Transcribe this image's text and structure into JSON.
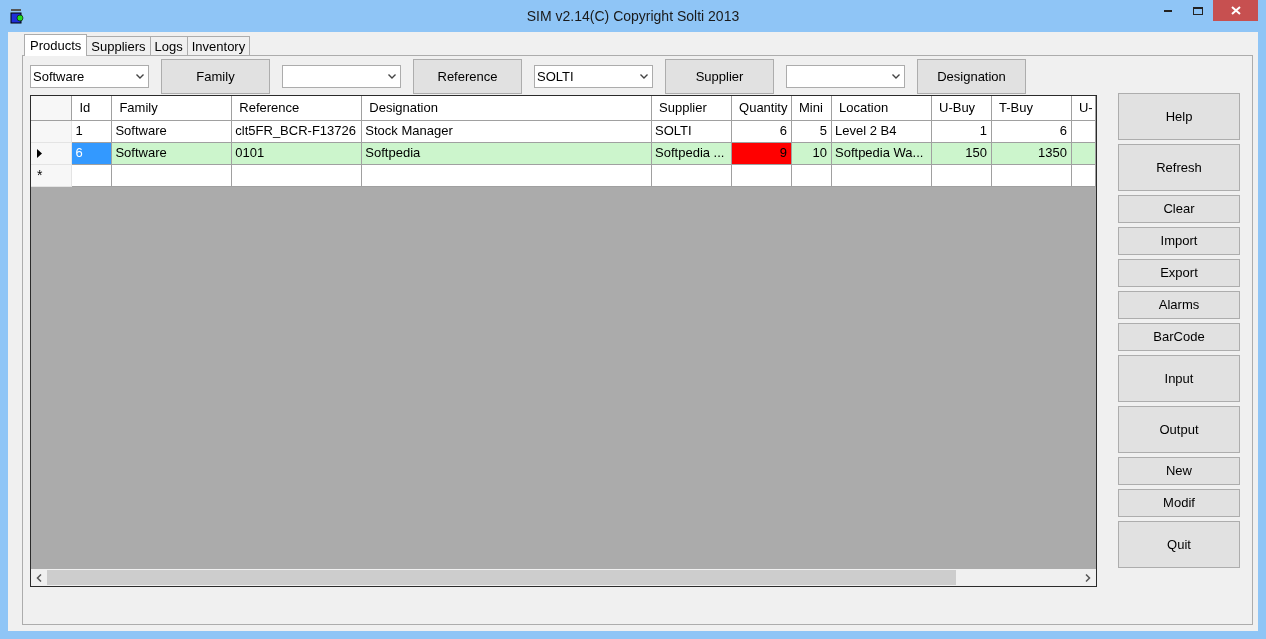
{
  "window": {
    "title": "SIM v2.14(C) Copyright Solti 2013"
  },
  "tabs": [
    {
      "label": "Products",
      "selected": true
    },
    {
      "label": "Suppliers",
      "selected": false
    },
    {
      "label": "Logs",
      "selected": false
    },
    {
      "label": "Inventory",
      "selected": false
    }
  ],
  "filters": [
    {
      "value": "Software",
      "button": "Family"
    },
    {
      "button": "Reference"
    },
    {
      "value": "SOLTI",
      "button": "Supplier"
    },
    {
      "button": "Designation"
    }
  ],
  "table": {
    "columns": [
      {
        "label": "Id",
        "kind": "text"
      },
      {
        "label": "Family",
        "kind": "text"
      },
      {
        "label": "Reference",
        "kind": "text"
      },
      {
        "label": "Designation",
        "kind": "text"
      },
      {
        "label": "Supplier",
        "kind": "text"
      },
      {
        "label": "Quantity",
        "kind": "number"
      },
      {
        "label": "Mini",
        "kind": "number"
      },
      {
        "label": "Location",
        "kind": "text"
      },
      {
        "label": "U-Buy",
        "kind": "number"
      },
      {
        "label": "T-Buy",
        "kind": "number"
      },
      {
        "label": "U-"
      }
    ],
    "rows": [
      {
        "selected": false,
        "current": false,
        "cells": [
          {
            "text": "1",
            "alert": false,
            "focused": false
          },
          {
            "text": "Software",
            "alert": false,
            "focused": false
          },
          {
            "text": "clt5FR_BCR-F13726",
            "alert": false,
            "focused": false
          },
          {
            "text": "Stock Manager",
            "alert": false,
            "focused": false
          },
          {
            "text": "SOLTI",
            "alert": false,
            "focused": false
          },
          {
            "text": "6",
            "alert": false,
            "focused": false
          },
          {
            "text": "5",
            "alert": false,
            "focused": false
          },
          {
            "text": "Level 2 B4",
            "alert": false,
            "focused": false
          },
          {
            "text": "1",
            "alert": false,
            "focused": false
          },
          {
            "text": "6",
            "alert": false,
            "focused": false
          }
        ]
      },
      {
        "selected": true,
        "current": true,
        "cells": [
          {
            "text": "6",
            "alert": false,
            "focused": true
          },
          {
            "text": "Software",
            "alert": false,
            "focused": false
          },
          {
            "text": "0101",
            "alert": false,
            "focused": false
          },
          {
            "text": "Softpedia",
            "alert": false,
            "focused": false
          },
          {
            "text": "Softpedia ...",
            "alert": false,
            "focused": false
          },
          {
            "text": "9",
            "alert": true,
            "focused": false
          },
          {
            "text": "10",
            "alert": false,
            "focused": false
          },
          {
            "text": "Softpedia Wa...",
            "alert": false,
            "focused": false
          },
          {
            "text": "150",
            "alert": false,
            "focused": false
          },
          {
            "text": "1350",
            "alert": false,
            "focused": false
          }
        ]
      }
    ],
    "new_row_marker": "*"
  },
  "buttons": [
    {
      "label": "Help",
      "kind": "large"
    },
    {
      "label": "Refresh",
      "kind": "large"
    },
    {
      "label": "Clear",
      "kind": "small"
    },
    {
      "label": "Import",
      "kind": "small"
    },
    {
      "label": "Export",
      "kind": "small"
    },
    {
      "label": "Alarms",
      "kind": "small"
    },
    {
      "label": "BarCode",
      "kind": "small"
    },
    {
      "label": "Input",
      "kind": "large"
    },
    {
      "label": "Output",
      "kind": "large"
    },
    {
      "label": "New",
      "kind": "small"
    },
    {
      "label": "Modif",
      "kind": "small"
    },
    {
      "label": "Quit",
      "kind": "large"
    }
  ]
}
